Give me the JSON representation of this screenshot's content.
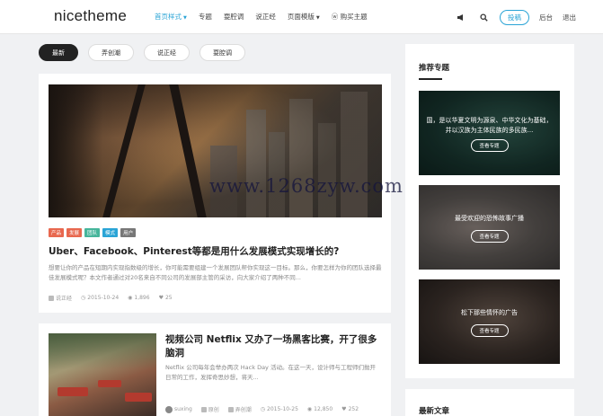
{
  "header": {
    "logo": "nicetheme",
    "nav": [
      {
        "label": "首页样式",
        "caret": true,
        "active": true
      },
      {
        "label": "专题",
        "caret": false,
        "active": false
      },
      {
        "label": "耍腔调",
        "caret": false,
        "active": false
      },
      {
        "label": "说正经",
        "caret": false,
        "active": false
      },
      {
        "label": "页面模版",
        "caret": true,
        "active": false
      },
      {
        "label": "购买主题",
        "caret": false,
        "active": false
      }
    ],
    "submit_label": "投稿",
    "admin_label": "后台",
    "logout_label": "退出"
  },
  "filters": [
    "最新",
    "弄创潮",
    "说正经",
    "耍腔调"
  ],
  "posts": [
    {
      "tags": [
        {
          "label": "产品",
          "color": "#e8684f"
        },
        {
          "label": "发展",
          "color": "#e8684f"
        },
        {
          "label": "团队",
          "color": "#46b59b"
        },
        {
          "label": "模式",
          "color": "#2aa4d6"
        },
        {
          "label": "用户",
          "color": "#777777"
        }
      ],
      "title": "Uber、Facebook、Pinterest等都是用什么发展模式实现增长的?",
      "excerpt": "想要让你的产品在短期内实现指数级的增长，你可能需要组建一个发展团队帮你实现这一目标。那么，你要怎样为你的团队选择最佳发展模式呢？本文作者通过对20名来自不同公司的发展部主管的采访，向大家介绍了两种不同...",
      "category": "说正经",
      "date": "2015-10-24",
      "views": "1,896",
      "likes": "25"
    },
    {
      "title": "视频公司 Netflix 又办了一场黑客比赛，开了很多脑洞",
      "excerpt": "Netflix 公司每年会举办两次 Hack Day 活动。在这一天，设计师与工程师们抛开日常的工作，发挥奇思妙想，将天...",
      "author": "suxing",
      "category_a": "原创",
      "category_b": "弄创潮",
      "date": "2015-10-25",
      "views": "12,850",
      "likes": "252"
    }
  ],
  "sidebar": {
    "recommended_title": "推荐专题",
    "topics": [
      {
        "text": "国，是以华夏文明为源泉、中华文化为基础，并以汉族为主体民族的多民族...",
        "button": "查看专题"
      },
      {
        "text": "最受欢迎的恐怖故事广播",
        "button": "查看专题"
      },
      {
        "text": "松下那些情怀的广告",
        "button": "查看专题"
      }
    ],
    "latest_title": "最新文章"
  },
  "watermark": "www.1268zyw.com"
}
